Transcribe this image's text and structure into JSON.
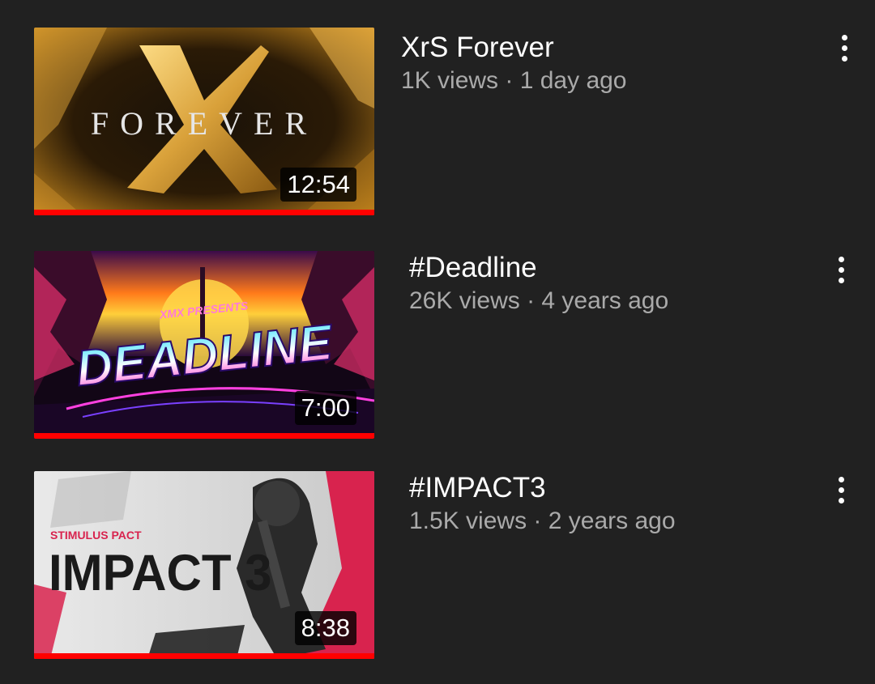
{
  "videos": [
    {
      "title": "XrS Forever",
      "views": "1K views",
      "age": "1 day ago",
      "duration": "12:54",
      "thumb_text": "FOREVER",
      "watched_fraction": 1.0
    },
    {
      "title": "#Deadline",
      "views": "26K views",
      "age": "4 years ago",
      "duration": "7:00",
      "thumb_text": "DEADLINE",
      "thumb_small_text": "XMX PRESENTS",
      "watched_fraction": 1.0
    },
    {
      "title": "#IMPACT3",
      "views": "1.5K views",
      "age": "2 years ago",
      "duration": "8:38",
      "thumb_text": "IMPACT 3",
      "thumb_small_text": "STIMULUS PACT",
      "watched_fraction": 1.0
    }
  ],
  "separator": " · ",
  "colors": {
    "background": "#212121",
    "progress": "#ff0000",
    "title": "#ffffff",
    "subtitle": "#aaaaaa"
  },
  "icons": {
    "menu": "more-vert-icon"
  }
}
